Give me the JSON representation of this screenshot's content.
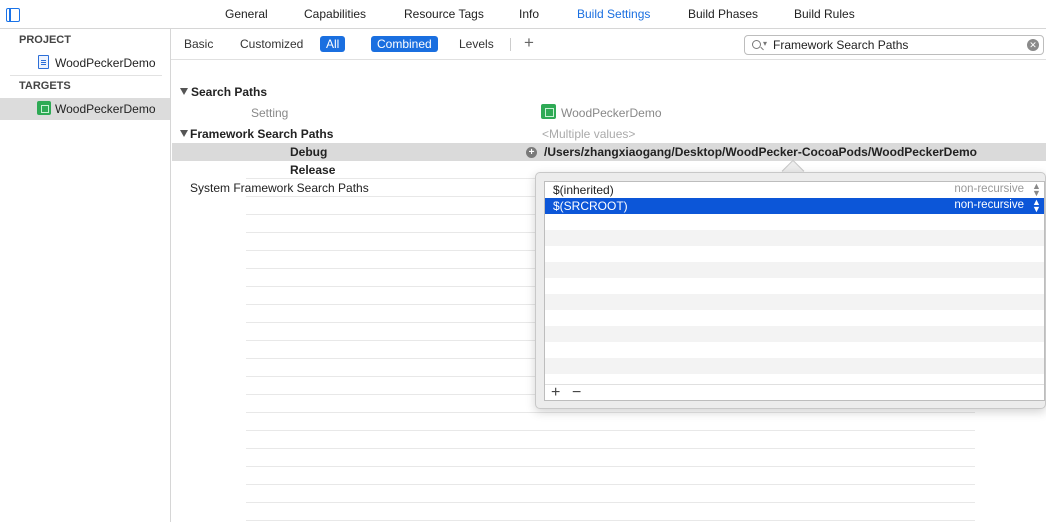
{
  "tabs": [
    {
      "label": "General",
      "active": false
    },
    {
      "label": "Capabilities",
      "active": false
    },
    {
      "label": "Resource Tags",
      "active": false
    },
    {
      "label": "Info",
      "active": false
    },
    {
      "label": "Build Settings",
      "active": true
    },
    {
      "label": "Build Phases",
      "active": false
    },
    {
      "label": "Build Rules",
      "active": false
    }
  ],
  "sidebar": {
    "project_header": "PROJECT",
    "project_item": "WoodPeckerDemo",
    "targets_header": "TARGETS",
    "target_item": "WoodPeckerDemo"
  },
  "filter": {
    "basic": "Basic",
    "customized": "Customized",
    "all": "All",
    "combined": "Combined",
    "levels": "Levels",
    "add": "+",
    "search_value": "Framework Search Paths"
  },
  "settings": {
    "section_title": "Search Paths",
    "col_setting": "Setting",
    "col_target": "WoodPeckerDemo",
    "framework_search_paths": "Framework Search Paths",
    "multiple_values": "<Multiple values>",
    "debug_label": "Debug",
    "debug_value": "/Users/zhangxiaogang/Desktop/WoodPecker-CocoaPods/WoodPeckerDemo",
    "release_label": "Release",
    "system_framework_search_paths": "System Framework Search Paths"
  },
  "popover": {
    "rows": [
      {
        "value": "$(inherited)",
        "recursive": "non-recursive",
        "selected": false
      },
      {
        "value": "$(SRCROOT)",
        "recursive": "non-recursive",
        "selected": true
      }
    ],
    "add": "+",
    "remove": "−"
  },
  "colors": {
    "accent": "#1a6fe0",
    "selection": "#0c56d8",
    "target_icon": "#2eaa55"
  }
}
